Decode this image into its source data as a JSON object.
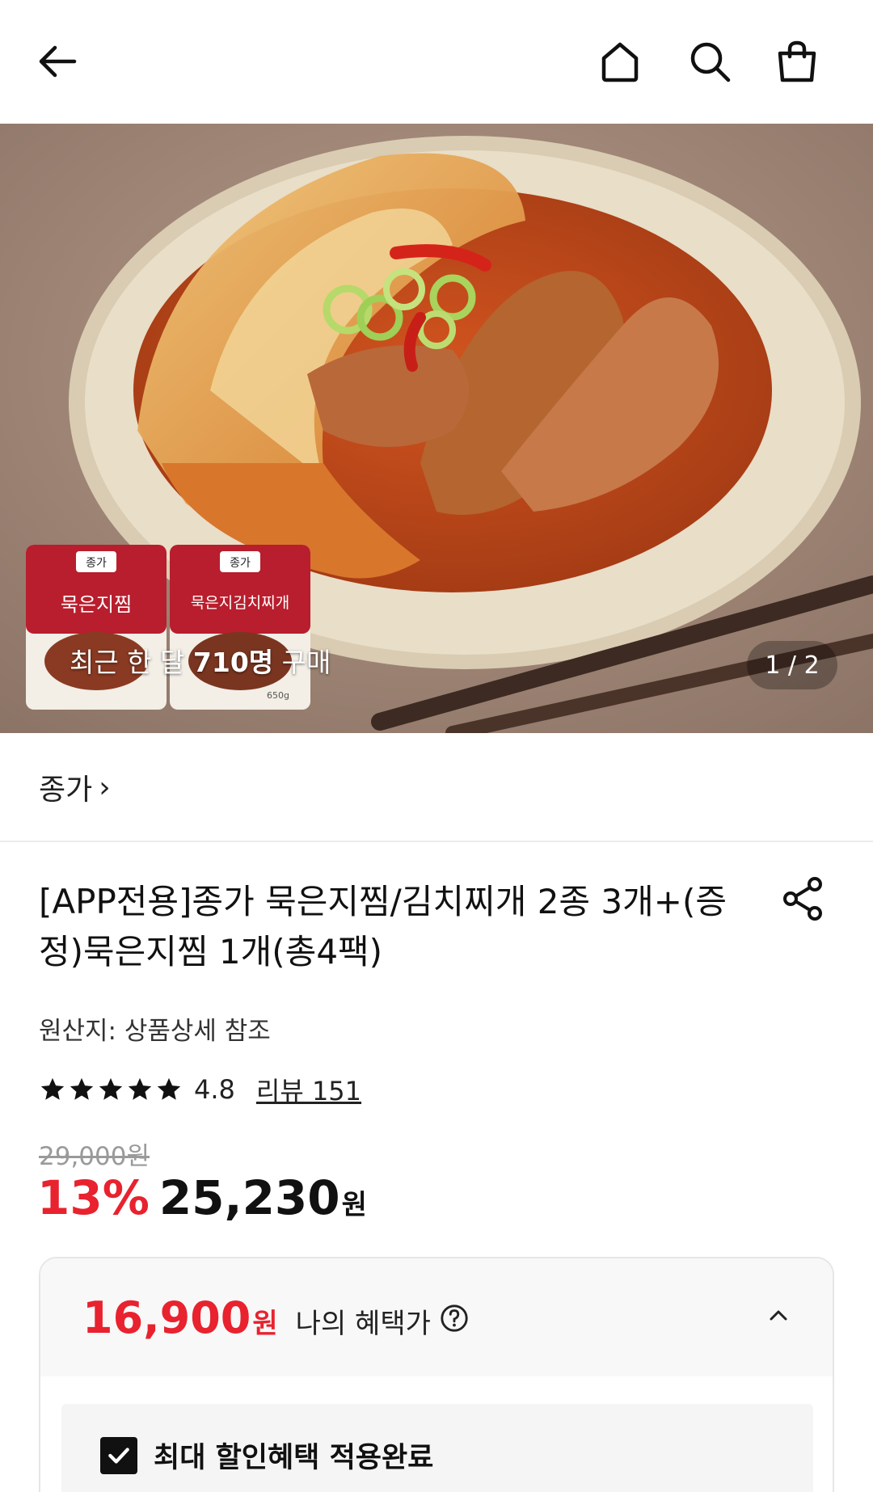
{
  "header": {
    "back_icon": "arrow-left-icon",
    "home_icon": "home-icon",
    "search_icon": "search-icon",
    "cart_icon": "shopping-bag-icon"
  },
  "hero": {
    "purchase_prefix": "최근 한 달 ",
    "purchase_count": "710명",
    "purchase_suffix": " 구매",
    "pager": "1 / 2",
    "pack1_brand": "종가",
    "pack1_name": "묵은지찜",
    "pack2_brand": "종가",
    "pack2_name": "묵은지김치찌개",
    "pack2_weight": "650g"
  },
  "brand": {
    "name": "종가",
    "chevron": "›"
  },
  "product": {
    "title": "[APP전용]종가 묵은지찜/김치찌개 2종 3개+(증정)묵은지찜 1개(총4팩)",
    "origin": "원산지: 상품상세 참조",
    "rating": "4.8",
    "rating_value": 4.8,
    "review_label": "리뷰 151",
    "original_price": "29,000원",
    "discount": "13%",
    "price": "25,230",
    "currency": "원"
  },
  "benefit": {
    "price": "16,900",
    "currency": "원",
    "label": "나의 혜택가",
    "applied_label": "최대 할인혜택 적용완료"
  },
  "colors": {
    "accent_red": "#e8222e",
    "text": "#111111",
    "muted": "#9a9a9a"
  }
}
